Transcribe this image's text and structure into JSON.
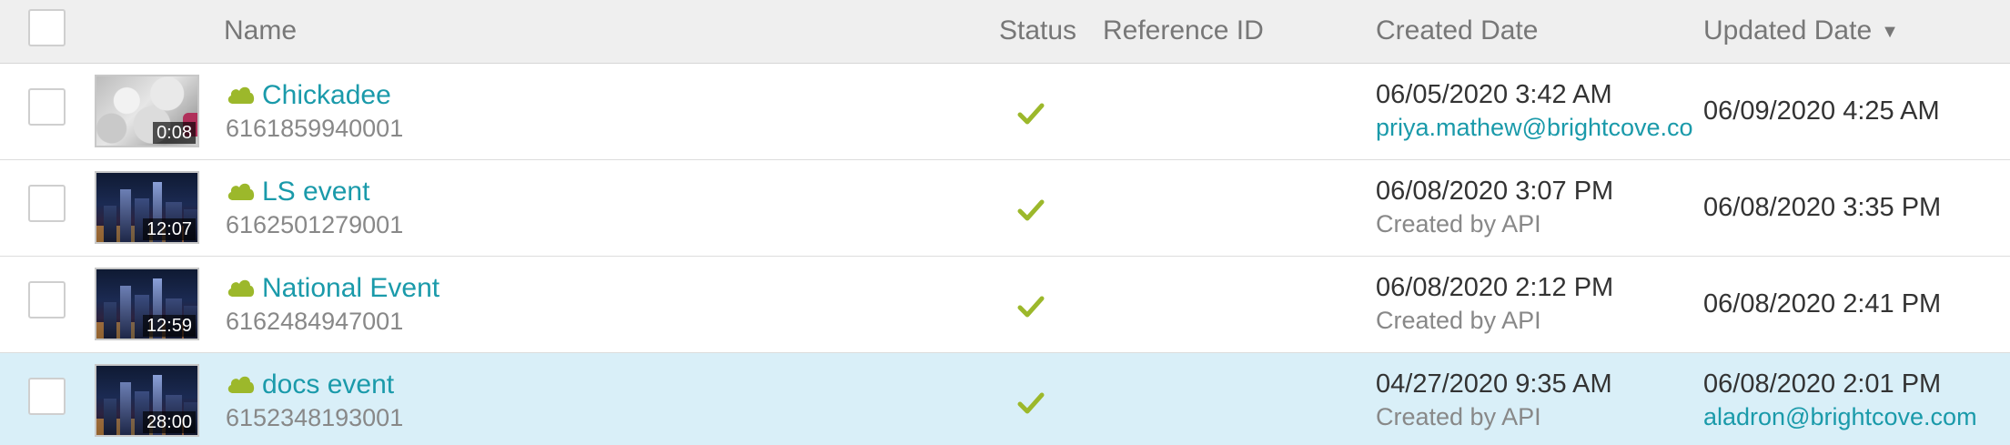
{
  "header": {
    "name": "Name",
    "status": "Status",
    "reference_id": "Reference ID",
    "created_date": "Created Date",
    "updated_date": "Updated Date",
    "sort_indicator": "▼"
  },
  "icons": {
    "cloud": "cloud-icon",
    "status_ok": "checkmark-icon",
    "sort": "sort-descending-icon"
  },
  "colors": {
    "link": "#1a9aaa",
    "cloud": "#9cb82b",
    "check": "#9cb82b",
    "header_bg": "#efefef",
    "selected_row_bg": "#d9eff8"
  },
  "rows": [
    {
      "name": "Chickadee",
      "id": "6161859940001",
      "duration": "0:08",
      "status": "active",
      "reference_id": "",
      "created_date": "06/05/2020 3:42 AM",
      "created_by": "priya.mathew@brightcove.com",
      "updated_date": "06/09/2020 4:25 AM",
      "updated_by": ""
    },
    {
      "name": "LS event",
      "id": "6162501279001",
      "duration": "12:07",
      "status": "active",
      "reference_id": "",
      "created_date": "06/08/2020 3:07 PM",
      "created_by": "Created by API",
      "updated_date": "06/08/2020 3:35 PM",
      "updated_by": ""
    },
    {
      "name": "National Event",
      "id": "6162484947001",
      "duration": "12:59",
      "status": "active",
      "reference_id": "",
      "created_date": "06/08/2020 2:12 PM",
      "created_by": "Created by API",
      "updated_date": "06/08/2020 2:41 PM",
      "updated_by": ""
    },
    {
      "name": "docs event",
      "id": "6152348193001",
      "duration": "28:00",
      "status": "active",
      "reference_id": "",
      "created_date": "04/27/2020 9:35 AM",
      "created_by": "Created by API",
      "updated_date": "06/08/2020 2:01 PM",
      "updated_by": "aladron@brightcove.com"
    }
  ]
}
